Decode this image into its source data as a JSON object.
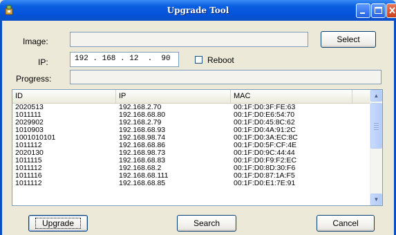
{
  "window": {
    "title": "Upgrade Tool"
  },
  "form": {
    "image_label": "Image:",
    "image_value": "",
    "select_label": "Select",
    "ip_label": "IP:",
    "ip_value": "192 . 168 . 12  .  90",
    "reboot_label": "Reboot",
    "reboot_checked": false,
    "progress_label": "Progress:"
  },
  "table": {
    "columns": [
      "ID",
      "IP",
      "MAC"
    ],
    "rows": [
      [
        "2020513",
        "192.168.2.70",
        "00:1F:D0:3F:FE:63"
      ],
      [
        "1011111",
        "192.168.68.80",
        "00:1F:D0:E6:54:70"
      ],
      [
        "2029902",
        "192.168.2.79",
        "00:1F:D0:45:8C:62"
      ],
      [
        "1010903",
        "192.168.68.93",
        "00:1F:D0:4A:91:2C"
      ],
      [
        "1001010101",
        "192.168.98.74",
        "00:1F:D0:3A:EC:8C"
      ],
      [
        "1011112",
        "192.168.68.86",
        "00:1F:D0:5F:CF:4E"
      ],
      [
        "2020130",
        "192.168.98.73",
        "00:1F:D0:9C:44:44"
      ],
      [
        "1011115",
        "192.168.68.83",
        "00:1F:D0:F9:F2:EC"
      ],
      [
        "1011112",
        "192.168.68.2",
        "00:1F:D0:8D:30:F6"
      ],
      [
        "1011116",
        "192.168.68.111",
        "00:1F:D0:87:1A:F5"
      ],
      [
        "1011112",
        "192.168.68.85",
        "00:1F:D0:E1:7E:91"
      ]
    ]
  },
  "buttons": {
    "upgrade": "Upgrade",
    "search": "Search",
    "cancel": "Cancel"
  },
  "colors": {
    "title_bar": "#0553d8",
    "window_bg": "#ece9d8",
    "close_button": "#c8401c"
  }
}
